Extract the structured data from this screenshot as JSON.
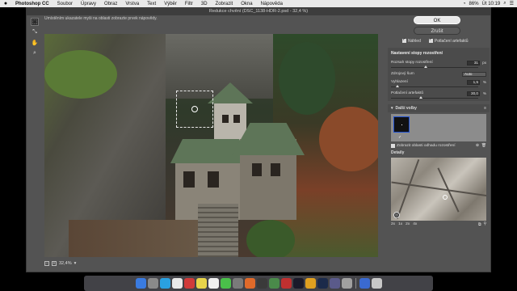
{
  "menubar": {
    "apple": "",
    "items": [
      "Photoshop CC",
      "Soubor",
      "Úpravy",
      "Obraz",
      "Vrstva",
      "Text",
      "Výběr",
      "Filtr",
      "3D",
      "Zobrazit",
      "Okna",
      "Nápověda"
    ],
    "status": [
      "86%",
      "Út 10:19"
    ]
  },
  "dialog": {
    "title": "Redukce chvění (DSC_1138-HDR-2.psd - 32,4 %)",
    "hint": "Umístěním ukazatele myši na oblasti zobrazte prvek nápovědy.",
    "zoom": "32,4%"
  },
  "panel": {
    "ok": "OK",
    "cancel": "Zrušit",
    "preview": "Náhled",
    "suppress_artifacts": "Potlačení artefaktů",
    "section_title": "Nastavení stopy rozostření",
    "trace_bounds": {
      "label": "Rozsah stopy rozostření",
      "value": "31",
      "unit": "px"
    },
    "noise": {
      "label": "Zdrojový šum",
      "value": "Auto"
    },
    "smoothing": {
      "label": "Vyhlazení",
      "value": "1,5",
      "unit": "%",
      "level": 0.05
    },
    "artifact_suppression": {
      "label": "Potlačení artefaktů",
      "value": "30,0",
      "unit": "%",
      "level": 0.3
    },
    "more_options": "Další volby",
    "estimate": "Zobrazit oblasti odhadu rozostření",
    "details": "Detaily",
    "zoom_levels": [
      "2x",
      "1x",
      "2x",
      "4x"
    ]
  }
}
